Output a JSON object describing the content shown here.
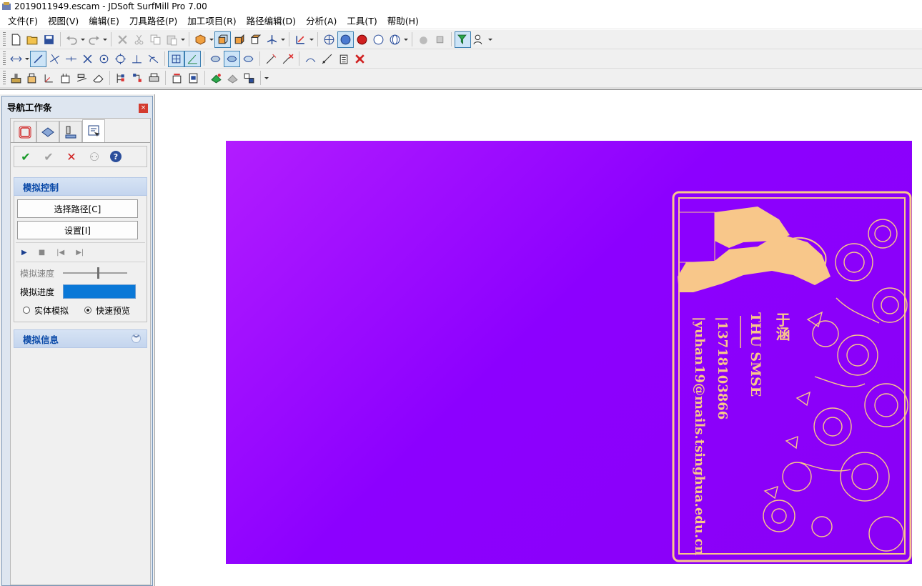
{
  "window": {
    "title": "2019011949.escam - JDSoft SurfMill Pro 7.00",
    "app_icon": "app-logo-icon"
  },
  "menu": {
    "items": [
      "文件(F)",
      "视图(V)",
      "编辑(E)",
      "刀具路径(P)",
      "加工项目(R)",
      "路径编辑(D)",
      "分析(A)",
      "工具(T)",
      "帮助(H)"
    ]
  },
  "nav_panel": {
    "title": "导航工作条",
    "close_label": "×",
    "tabs": [
      "model-icon",
      "surface-icon",
      "tool-icon",
      "simulation-icon"
    ],
    "actions": {
      "ok": "✔",
      "apply": "✔",
      "cancel": "✕",
      "browse": "⚇",
      "help": "?"
    },
    "sim_control": {
      "header": "模拟控制",
      "select_path_button": "选择路径[C]",
      "settings_button": "设置[I]",
      "speed_label": "模拟速度",
      "progress_label": "模拟进度",
      "speed_value": 0.55,
      "radio_solid": "实体模拟",
      "radio_fast": "快速预览",
      "selected_mode": "快速预览"
    },
    "sim_info": {
      "header": "模拟信息",
      "expand_icon": "double-chevron-down-icon"
    }
  },
  "card": {
    "name": "于涵",
    "org": "THU SMSE",
    "phone": "|13718103866",
    "email": "|yuhan19@mails.tsinghua.edu.cn",
    "colors": {
      "background_start": "#b21cff",
      "background_end": "#8a00f5",
      "ink": "#f8c78a"
    }
  }
}
